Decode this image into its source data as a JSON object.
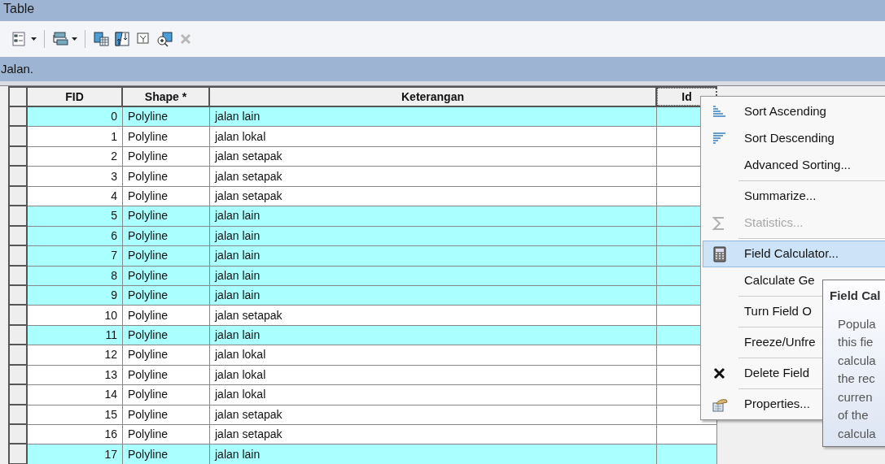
{
  "window": {
    "title": "Table"
  },
  "toolbar": [
    {
      "kind": "options",
      "dropdown": true
    },
    {
      "kind": "related",
      "dropdown": true
    },
    {
      "kind": "select"
    },
    {
      "kind": "switch"
    },
    {
      "kind": "clear"
    },
    {
      "kind": "zoom"
    },
    {
      "kind": "delete",
      "disabled": true
    }
  ],
  "tab": {
    "label": "Jalan."
  },
  "table": {
    "columns": [
      "FID",
      "Shape *",
      "Keterangan",
      "Id"
    ],
    "rows": [
      {
        "cells": [
          "0",
          "Polyline",
          "jalan lain",
          ""
        ],
        "selected": true
      },
      {
        "cells": [
          "1",
          "Polyline",
          "jalan lokal",
          ""
        ],
        "selected": false
      },
      {
        "cells": [
          "2",
          "Polyline",
          "jalan setapak",
          ""
        ],
        "selected": false
      },
      {
        "cells": [
          "3",
          "Polyline",
          "jalan setapak",
          ""
        ],
        "selected": false
      },
      {
        "cells": [
          "4",
          "Polyline",
          "jalan setapak",
          ""
        ],
        "selected": false
      },
      {
        "cells": [
          "5",
          "Polyline",
          "jalan lain",
          ""
        ],
        "selected": true
      },
      {
        "cells": [
          "6",
          "Polyline",
          "jalan lain",
          ""
        ],
        "selected": true
      },
      {
        "cells": [
          "7",
          "Polyline",
          "jalan lain",
          ""
        ],
        "selected": true
      },
      {
        "cells": [
          "8",
          "Polyline",
          "jalan lain",
          ""
        ],
        "selected": true
      },
      {
        "cells": [
          "9",
          "Polyline",
          "jalan lain",
          ""
        ],
        "selected": true
      },
      {
        "cells": [
          "10",
          "Polyline",
          "jalan setapak",
          ""
        ],
        "selected": false
      },
      {
        "cells": [
          "11",
          "Polyline",
          "jalan lain",
          ""
        ],
        "selected": true
      },
      {
        "cells": [
          "12",
          "Polyline",
          "jalan lokal",
          ""
        ],
        "selected": false
      },
      {
        "cells": [
          "13",
          "Polyline",
          "jalan lokal",
          ""
        ],
        "selected": false
      },
      {
        "cells": [
          "14",
          "Polyline",
          "jalan lokal",
          ""
        ],
        "selected": false
      },
      {
        "cells": [
          "15",
          "Polyline",
          "jalan setapak",
          ""
        ],
        "selected": false
      },
      {
        "cells": [
          "16",
          "Polyline",
          "jalan setapak",
          ""
        ],
        "selected": false
      },
      {
        "cells": [
          "17",
          "Polyline",
          "jalan lain",
          ""
        ],
        "selected": true
      }
    ]
  },
  "context_menu": [
    {
      "kind": "item",
      "label": "Sort Ascending",
      "disabled": false,
      "selected": false
    },
    {
      "kind": "item",
      "label": "Sort Descending",
      "disabled": false,
      "selected": false
    },
    {
      "kind": "item",
      "label": "Advanced Sorting...",
      "disabled": false,
      "selected": false
    },
    {
      "kind": "separator"
    },
    {
      "kind": "item",
      "label": "Summarize...",
      "disabled": false,
      "selected": false
    },
    {
      "kind": "item",
      "label": "Statistics...",
      "disabled": true,
      "selected": false
    },
    {
      "kind": "separator"
    },
    {
      "kind": "item",
      "label": "Field Calculator...",
      "disabled": false,
      "selected": true
    },
    {
      "kind": "item",
      "label": "Calculate Ge",
      "disabled": false,
      "selected": false
    },
    {
      "kind": "separator"
    },
    {
      "kind": "item",
      "label": "Turn Field O",
      "disabled": false,
      "selected": false
    },
    {
      "kind": "separator"
    },
    {
      "kind": "item",
      "label": "Freeze/Unfre",
      "disabled": false,
      "selected": false
    },
    {
      "kind": "separator"
    },
    {
      "kind": "item",
      "label": "Delete Field",
      "disabled": false,
      "selected": false
    },
    {
      "kind": "separator"
    },
    {
      "kind": "item",
      "label": "Properties...",
      "disabled": false,
      "selected": false
    }
  ],
  "tooltip": {
    "title": "Field Cal",
    "lines": [
      "Popula",
      "this fie",
      "calcula",
      "the rec",
      "curren",
      "of the",
      "calcula"
    ]
  }
}
